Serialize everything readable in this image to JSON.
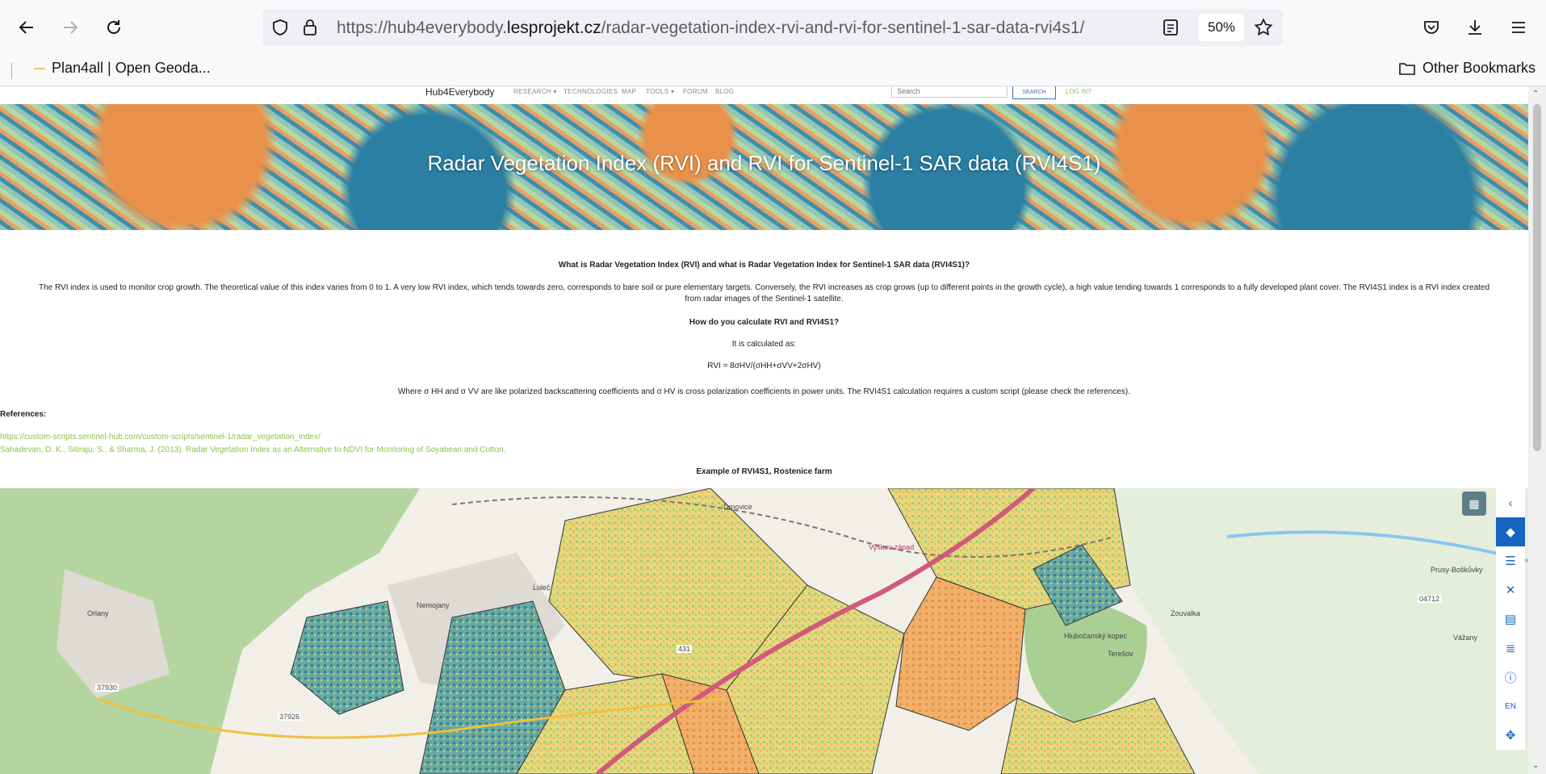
{
  "browser": {
    "url_prefix": "https://hub4everybody.",
    "url_domain": "lesprojekt.cz",
    "url_path": "/radar-vegetation-index-rvi-and-rvi-for-sentinel-1-sar-data-rvi4s1/",
    "zoom": "50%",
    "bookmark": "Plan4all | Open Geoda...",
    "other_bookmarks": "Other Bookmarks"
  },
  "site": {
    "brand": "Hub4Everybody",
    "menu": [
      "RESEARCH ▾",
      "TECHNOLOGIES",
      "MAP",
      "TOOLS ▾",
      "FORUM",
      "BLOG"
    ],
    "search_placeholder": "Search",
    "search_button": "SEARCH",
    "login": "LOG IN?"
  },
  "hero": {
    "title": "Radar Vegetation Index (RVI) and RVI for Sentinel-1 SAR data (RVI4S1)"
  },
  "article": {
    "heading1": "What is Radar Vegetation Index (RVI) and what is Radar Vegetation Index for Sentinel-1 SAR data (RVI4S1)?",
    "para1_line1": "The RVI index is used to monitor crop growth. The theoretical value of this index varies from 0 to 1. A very low RVI index, which tends towards zero, corresponds to bare soil or pure elementary targets. Conversely, the RVI increases as crop grows (up to different points in the growth cycle), a high value tending towards 1 corresponds to a fully developed plant cover. The RVI4S1 index is a RVI index created",
    "para1_line2": "from radar images of the Sentinel-1 satellite.",
    "heading2": "How do you calculate RVI and RVI4S1?",
    "calc_intro": "It is calculated as:",
    "formula": "RVI = 8σHV/(σHH+σVV+2σHV)",
    "where": "Where σ HH and σ VV are like polarized backscattering coefficients and σ HV is cross polarization coefficients in power units. The RVI4S1 calculation requires a custom script (please check the references).",
    "references_label": "References:",
    "ref1": "https://custom-scripts.sentinel-hub.com/custom-scripts/sentinel-1/radar_vegetation_index/",
    "ref2": "Sahadevan, D. K., Sitiraju, S., & Sharma, J. (2013). Radar Vegetation Index as an Alternative to NDVI for Monitoring of Soyabean and Cotton.",
    "example_heading": "Example of RVI4S1, Rostenice farm"
  },
  "map": {
    "labels": [
      "Orlany",
      "Nemojany",
      "Luleč",
      "Drnovice",
      "Vyškov-západ",
      "Prusy-Boškůvky",
      "Hlubočanský kopec",
      "Zouvalka",
      "Vážany",
      "Terešov",
      "37930",
      "37926",
      "431",
      "04712"
    ],
    "controls": [
      "chevron-left",
      "layers",
      "list",
      "close",
      "map",
      "database",
      "info",
      "EN",
      "move"
    ]
  }
}
